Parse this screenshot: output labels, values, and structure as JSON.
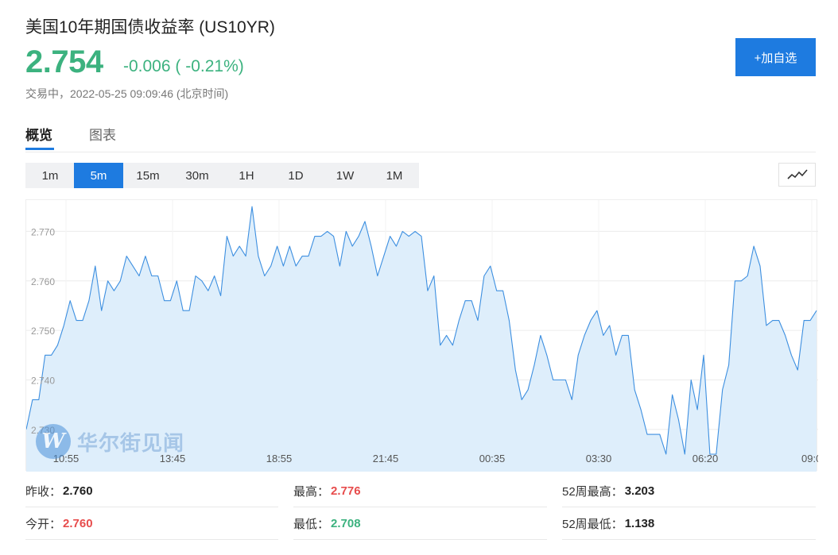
{
  "header": {
    "title": "美国10年期国债收益率 (US10YR)",
    "price": "2.754",
    "change": "-0.006 ( -0.21%)",
    "status": "交易中，2022-05-25 09:09:46 (北京时间)",
    "add_button": "+加自选",
    "accent_color": "#1e7be0",
    "down_color": "#3cb27f",
    "up_color": "#e74c4c"
  },
  "tabs": [
    {
      "label": "概览",
      "active": true
    },
    {
      "label": "图表",
      "active": false
    }
  ],
  "intervals": [
    {
      "label": "1m",
      "active": false
    },
    {
      "label": "5m",
      "active": true
    },
    {
      "label": "15m",
      "active": false
    },
    {
      "label": "30m",
      "active": false
    },
    {
      "label": "1H",
      "active": false
    },
    {
      "label": "1D",
      "active": false
    },
    {
      "label": "1W",
      "active": false
    },
    {
      "label": "1M",
      "active": false
    }
  ],
  "chart_type_icon": "line-chart-icon",
  "watermark": {
    "logo": "W",
    "text": "华尔街见闻"
  },
  "chart_data": {
    "type": "area",
    "ylim": [
      2.725,
      2.776
    ],
    "y_ticks": [
      "2.770",
      "2.760",
      "2.750",
      "2.740",
      "2.730"
    ],
    "x_ticks": [
      "10:55",
      "13:45",
      "18:55",
      "21:45",
      "00:35",
      "03:30",
      "06:20",
      "09:0"
    ],
    "grid": true,
    "line_color": "#3d8fe0",
    "fill_color": "#deeefb",
    "values": [
      2.73,
      2.736,
      2.736,
      2.745,
      2.745,
      2.747,
      2.751,
      2.756,
      2.752,
      2.752,
      2.756,
      2.763,
      2.754,
      2.76,
      2.758,
      2.76,
      2.765,
      2.763,
      2.761,
      2.765,
      2.761,
      2.761,
      2.756,
      2.756,
      2.76,
      2.754,
      2.754,
      2.761,
      2.76,
      2.758,
      2.761,
      2.757,
      2.769,
      2.765,
      2.767,
      2.765,
      2.775,
      2.765,
      2.761,
      2.763,
      2.767,
      2.763,
      2.767,
      2.763,
      2.765,
      2.765,
      2.769,
      2.769,
      2.77,
      2.769,
      2.763,
      2.77,
      2.767,
      2.769,
      2.772,
      2.767,
      2.761,
      2.765,
      2.769,
      2.767,
      2.77,
      2.769,
      2.77,
      2.769,
      2.758,
      2.761,
      2.747,
      2.749,
      2.747,
      2.752,
      2.756,
      2.756,
      2.752,
      2.761,
      2.763,
      2.758,
      2.758,
      2.752,
      2.742,
      2.736,
      2.738,
      2.743,
      2.749,
      2.745,
      2.74,
      2.74,
      2.74,
      2.736,
      2.745,
      2.749,
      2.752,
      2.754,
      2.749,
      2.751,
      2.745,
      2.749,
      2.749,
      2.738,
      2.734,
      2.729,
      2.729,
      2.729,
      2.725,
      2.737,
      2.732,
      2.725,
      2.74,
      2.734,
      2.745,
      2.725,
      2.725,
      2.738,
      2.743,
      2.76,
      2.76,
      2.761,
      2.767,
      2.763,
      2.751,
      2.752,
      2.752,
      2.749,
      2.745,
      2.742,
      2.752,
      2.752,
      2.754
    ]
  },
  "stats": [
    {
      "label": "昨收：",
      "value": "2.760",
      "tone": "neutral"
    },
    {
      "label": "最高：",
      "value": "2.776",
      "tone": "up"
    },
    {
      "label": "52周最高：",
      "value": "3.203",
      "tone": "neutral"
    },
    {
      "label": "今开：",
      "value": "2.760",
      "tone": "up"
    },
    {
      "label": "最低：",
      "value": "2.708",
      "tone": "down"
    },
    {
      "label": "52周最低：",
      "value": "1.138",
      "tone": "neutral"
    }
  ]
}
